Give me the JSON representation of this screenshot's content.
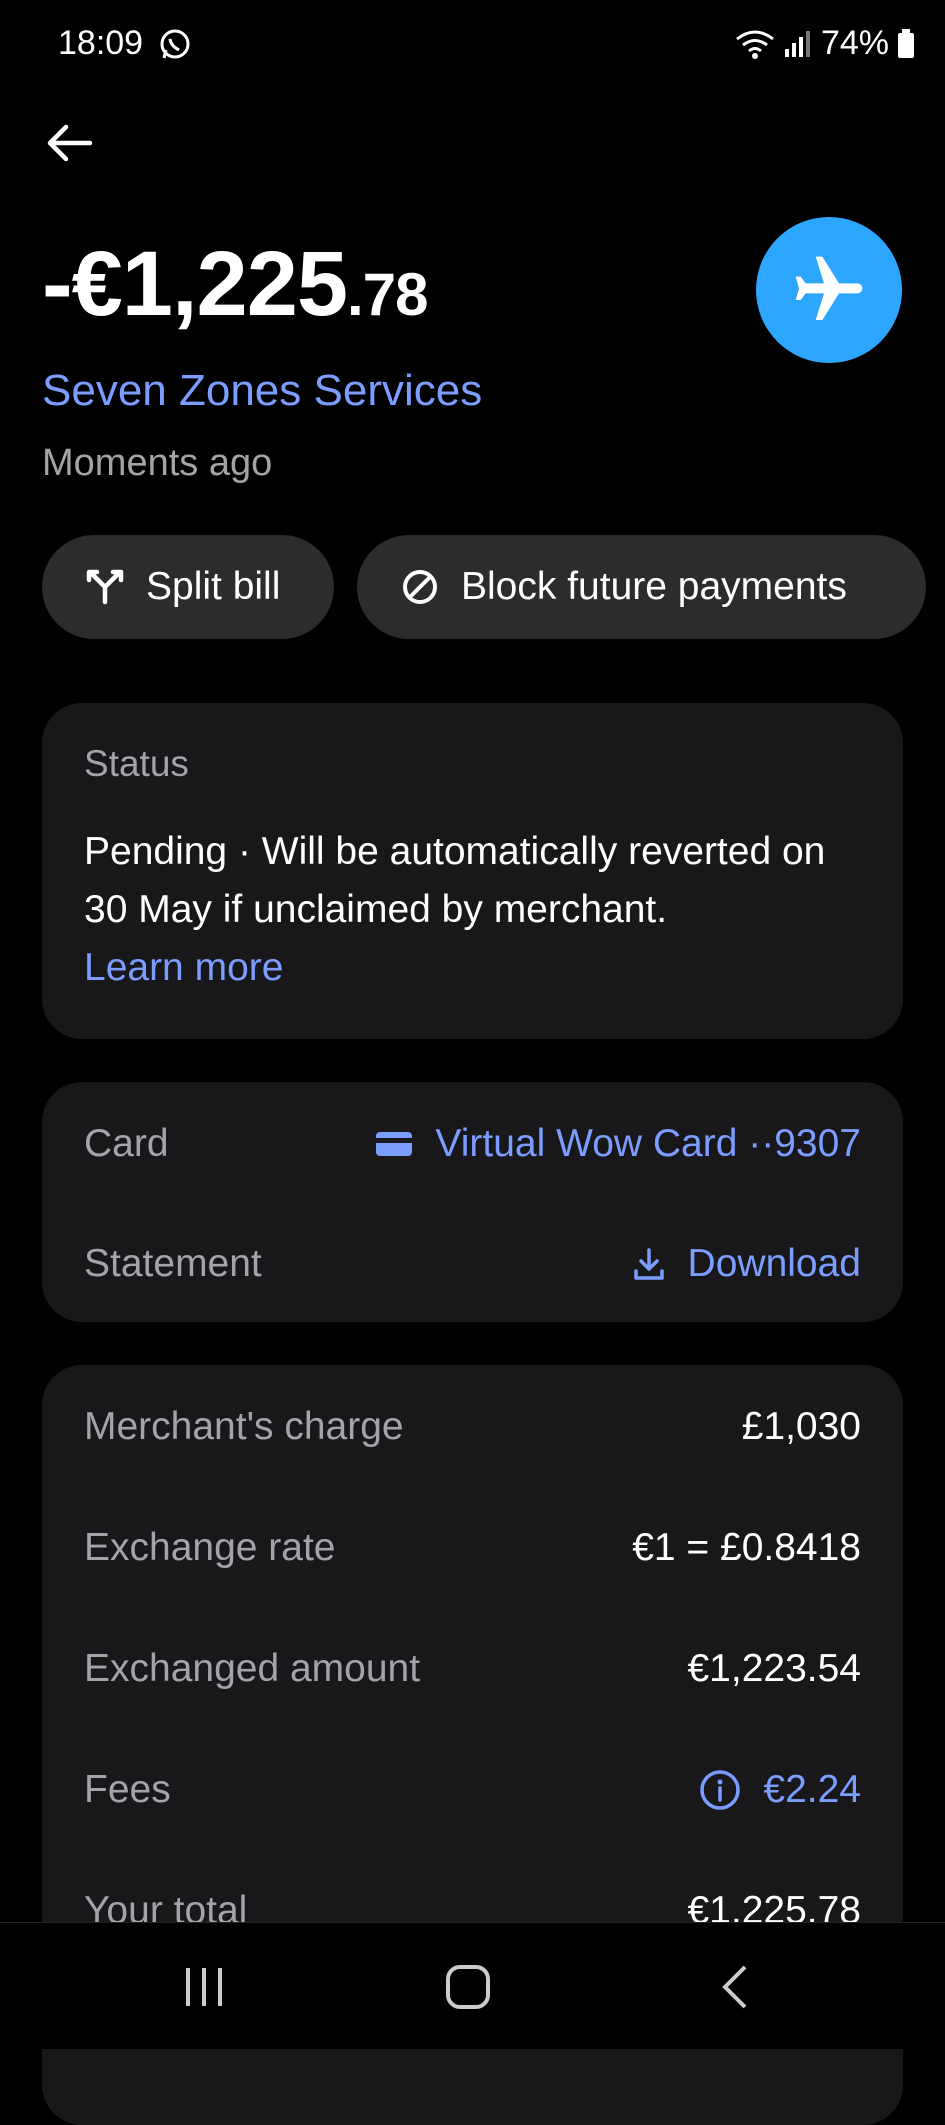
{
  "status_bar": {
    "time": "18:09",
    "battery": "74%"
  },
  "transaction": {
    "amount_main": "-€1,225",
    "amount_cents": ".78",
    "merchant": "Seven Zones Services",
    "time_ago": "Moments ago",
    "merchant_icon": "airplane-icon"
  },
  "actions": {
    "split_label": "Split bill",
    "block_label": "Block future payments"
  },
  "status": {
    "label": "Status",
    "text": "Pending · Will be automatically reverted on 30 May if unclaimed by merchant.",
    "link": "Learn more"
  },
  "card_info": {
    "card_label": "Card",
    "card_value": "Virtual Wow Card ··9307",
    "statement_label": "Statement",
    "statement_value": "Download"
  },
  "charges": {
    "merchant_charge_label": "Merchant's charge",
    "merchant_charge_value": "£1,030",
    "rate_label": "Exchange rate",
    "rate_value": "€1 = £0.8418",
    "exchanged_label": "Exchanged amount",
    "exchanged_value": "€1,223.54",
    "fees_label": "Fees",
    "fees_value": "€2.24",
    "total_label": "Your total",
    "total_value": "€1,225.78"
  },
  "colors": {
    "accent": "#7b9dff",
    "avatar": "#2da6ff",
    "card_bg": "#18181a",
    "chip_bg": "#2c2c2e"
  }
}
